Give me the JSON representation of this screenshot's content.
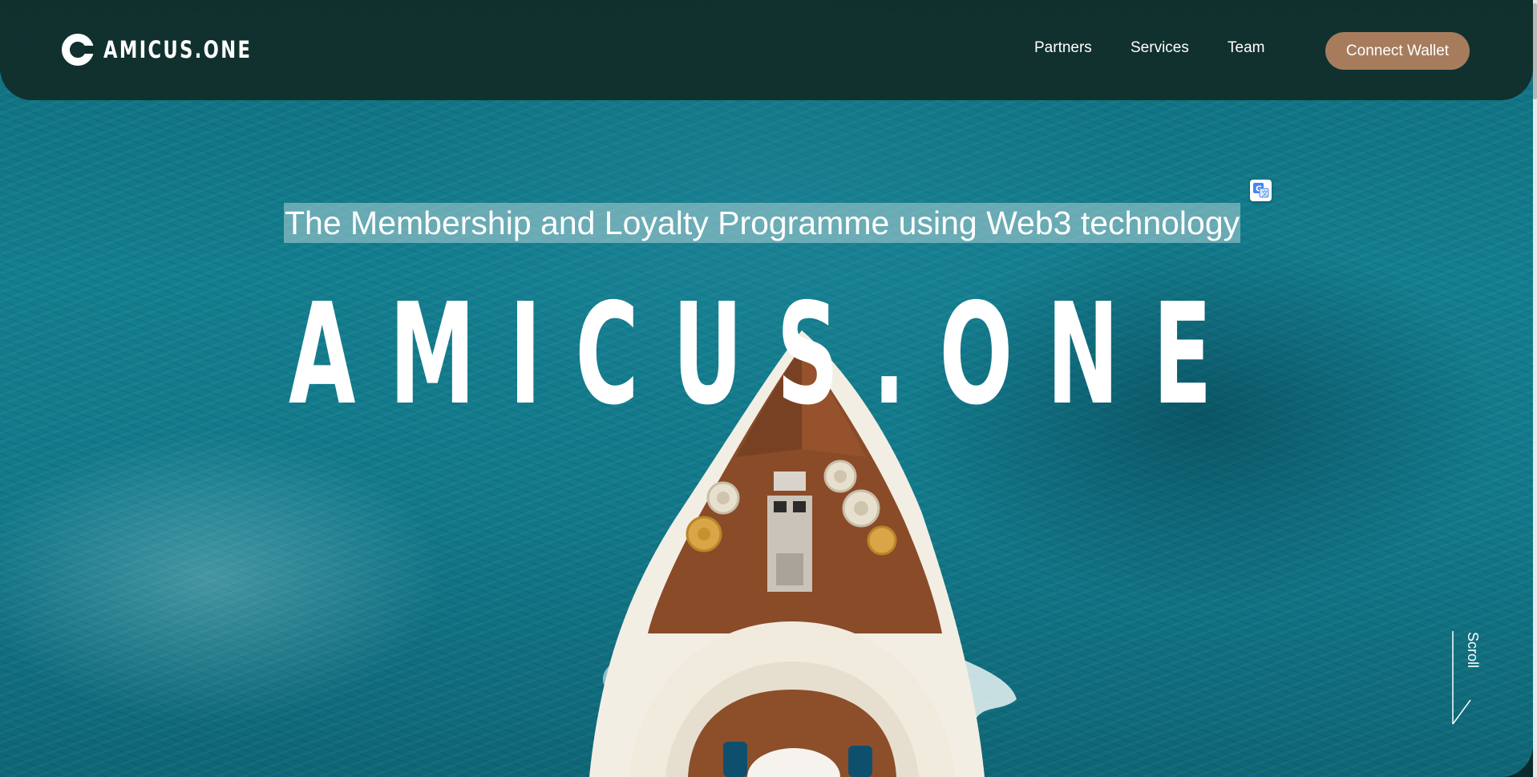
{
  "header": {
    "brand": "AMICUS.ONE",
    "nav": [
      {
        "label": "Partners"
      },
      {
        "label": "Services"
      },
      {
        "label": "Team"
      }
    ],
    "cta_label": "Connect Wallet"
  },
  "hero": {
    "tagline": "The Membership and Loyalty Programme using Web3 technology",
    "title": "AMICUS.ONE",
    "scroll_label": "Scroll"
  },
  "icons": {
    "logo": "ring-logo-icon",
    "translate": "google-translate-icon",
    "scroll": "scroll-arrow-icon"
  },
  "colors": {
    "header_bg": "#112d29",
    "cta_bg": "#a67c5d",
    "ocean": "#137e8f",
    "text": "#ffffff"
  }
}
